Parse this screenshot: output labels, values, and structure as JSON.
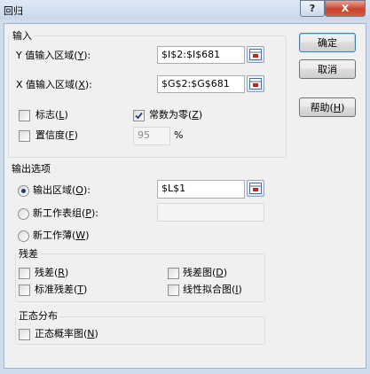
{
  "window": {
    "title": "回归",
    "help_symbol": "?",
    "close_symbol": "X"
  },
  "input": {
    "group_title": "输入",
    "y_range": {
      "label": "Y 值输入区域(",
      "key": "Y",
      "tail": "):",
      "value": "$I$2:$I$681"
    },
    "x_range": {
      "label": "X 值输入区域(",
      "key": "X",
      "tail": "):",
      "value": "$G$2:$G$681"
    },
    "labels": {
      "label": "标志(",
      "key": "L",
      "tail": ")",
      "checked": false
    },
    "const_zero": {
      "label": "常数为零(",
      "key": "Z",
      "tail": ")",
      "checked": true
    },
    "confidence": {
      "label": "置信度(",
      "key": "F",
      "tail": ")",
      "checked": false,
      "value": "95",
      "unit": "%"
    }
  },
  "output": {
    "group_title": "输出选项",
    "output_range": {
      "label": "输出区域(",
      "key": "O",
      "tail": "):",
      "selected": true,
      "value": "$L$1"
    },
    "new_sheet": {
      "label": "新工作表组(",
      "key": "P",
      "tail": "):",
      "selected": false,
      "value": ""
    },
    "new_workbook": {
      "label": "新工作薄(",
      "key": "W",
      "tail": ")",
      "selected": false
    }
  },
  "residuals": {
    "group_title": "残差",
    "residuals": {
      "label": "残差(",
      "key": "R",
      "tail": ")",
      "checked": false
    },
    "standardized": {
      "label": "标准残差(",
      "key": "T",
      "tail": ")",
      "checked": false
    },
    "residual_plot": {
      "label": "残差图(",
      "key": "D",
      "tail": ")",
      "checked": false
    },
    "line_fit_plot": {
      "label": "线性拟合图(",
      "key": "I",
      "tail": ")",
      "checked": false
    }
  },
  "normal": {
    "group_title": "正态分布",
    "normal_plot": {
      "label": "正态概率图(",
      "key": "N",
      "tail": ")",
      "checked": false
    }
  },
  "buttons": {
    "ok": "确定",
    "cancel": "取消",
    "help": "帮助(",
    "help_key": "H",
    "help_tail": ")"
  },
  "colors": {
    "checkmark": "#1c3f7a",
    "ref_icon": "#c8211b"
  }
}
